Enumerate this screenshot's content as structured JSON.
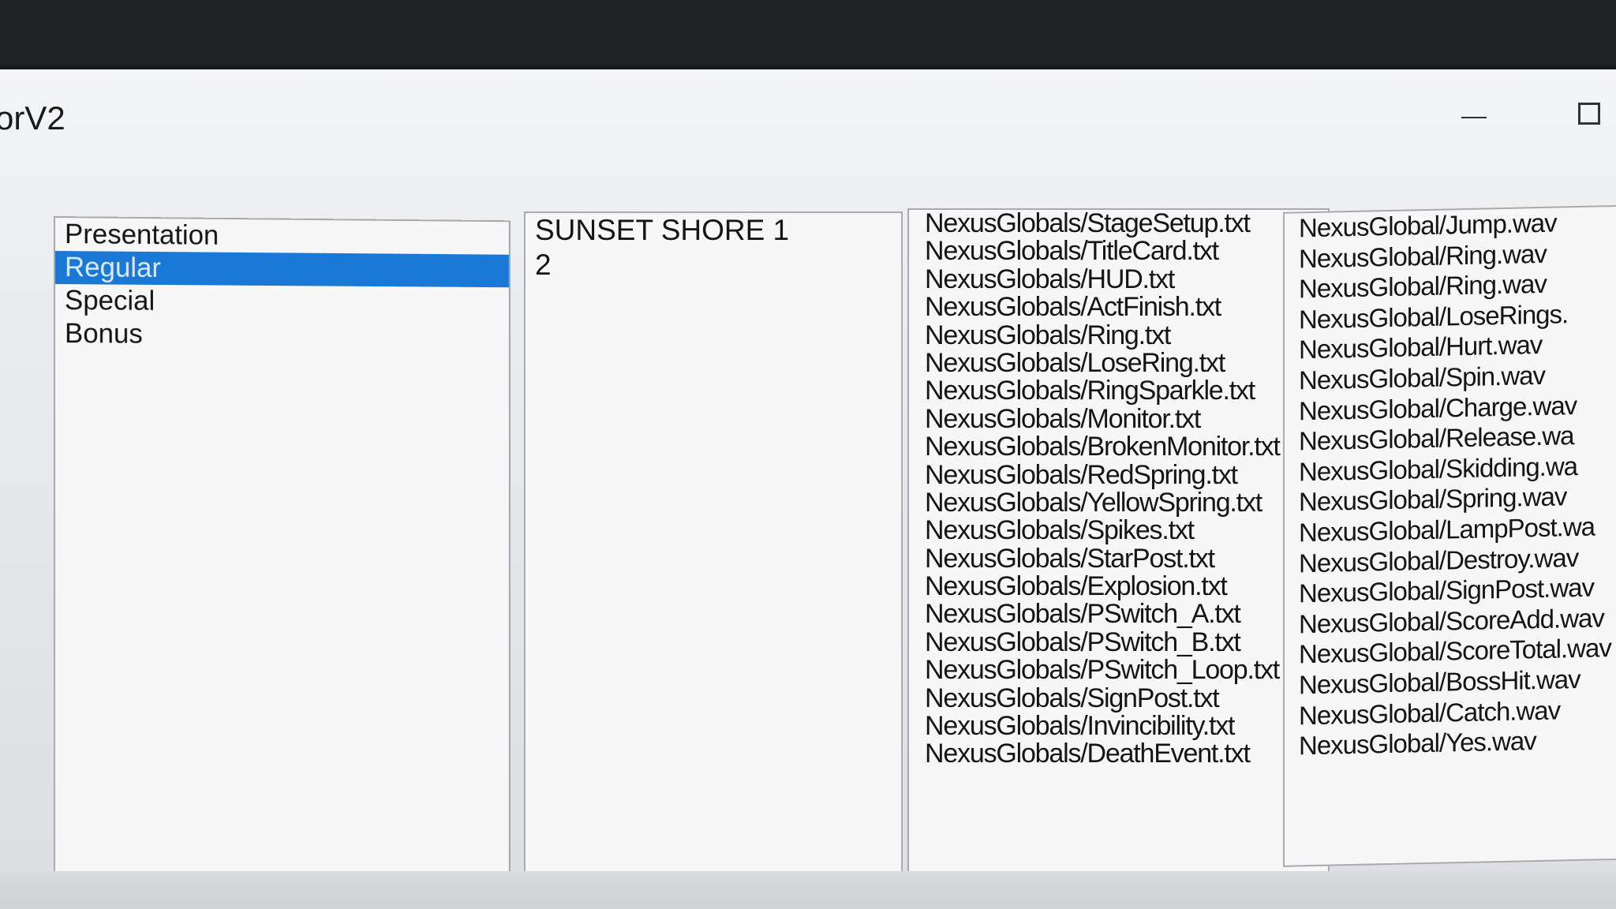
{
  "window": {
    "title": "orV2"
  },
  "category_list": {
    "items": [
      {
        "label": "Presentation",
        "selected": false
      },
      {
        "label": "Regular",
        "selected": true
      },
      {
        "label": "Special",
        "selected": false
      },
      {
        "label": "Bonus",
        "selected": false
      }
    ]
  },
  "stage_list": {
    "items": [
      "SUNSET SHORE 1",
      "2"
    ]
  },
  "object_list": {
    "items": [
      "NexusGlobals/StageSetup.txt",
      "NexusGlobals/TitleCard.txt",
      "NexusGlobals/HUD.txt",
      "NexusGlobals/ActFinish.txt",
      "NexusGlobals/Ring.txt",
      "NexusGlobals/LoseRing.txt",
      "NexusGlobals/RingSparkle.txt",
      "NexusGlobals/Monitor.txt",
      "NexusGlobals/BrokenMonitor.txt",
      "NexusGlobals/RedSpring.txt",
      "NexusGlobals/YellowSpring.txt",
      "NexusGlobals/Spikes.txt",
      "NexusGlobals/StarPost.txt",
      "NexusGlobals/Explosion.txt",
      "NexusGlobals/PSwitch_A.txt",
      "NexusGlobals/PSwitch_B.txt",
      "NexusGlobals/PSwitch_Loop.txt",
      "NexusGlobals/SignPost.txt",
      "NexusGlobals/Invincibility.txt",
      "NexusGlobals/DeathEvent.txt"
    ]
  },
  "sound_list": {
    "items": [
      "NexusGlobal/Jump.wav",
      "NexusGlobal/Ring.wav",
      "NexusGlobal/Ring.wav",
      "NexusGlobal/LoseRings.",
      "NexusGlobal/Hurt.wav",
      "NexusGlobal/Spin.wav",
      "NexusGlobal/Charge.wav",
      "NexusGlobal/Release.wa",
      "NexusGlobal/Skidding.wa",
      "NexusGlobal/Spring.wav",
      "NexusGlobal/LampPost.wa",
      "NexusGlobal/Destroy.wav",
      "NexusGlobal/SignPost.wav",
      "NexusGlobal/ScoreAdd.wav",
      "NexusGlobal/ScoreTotal.wav",
      "NexusGlobal/BossHit.wav",
      "NexusGlobal/Catch.wav",
      "NexusGlobal/Yes.wav"
    ]
  },
  "colors": {
    "selection": "#1a78d6",
    "window_bg": "#e6e8eb",
    "listbox_bg": "#f7f7f8"
  }
}
